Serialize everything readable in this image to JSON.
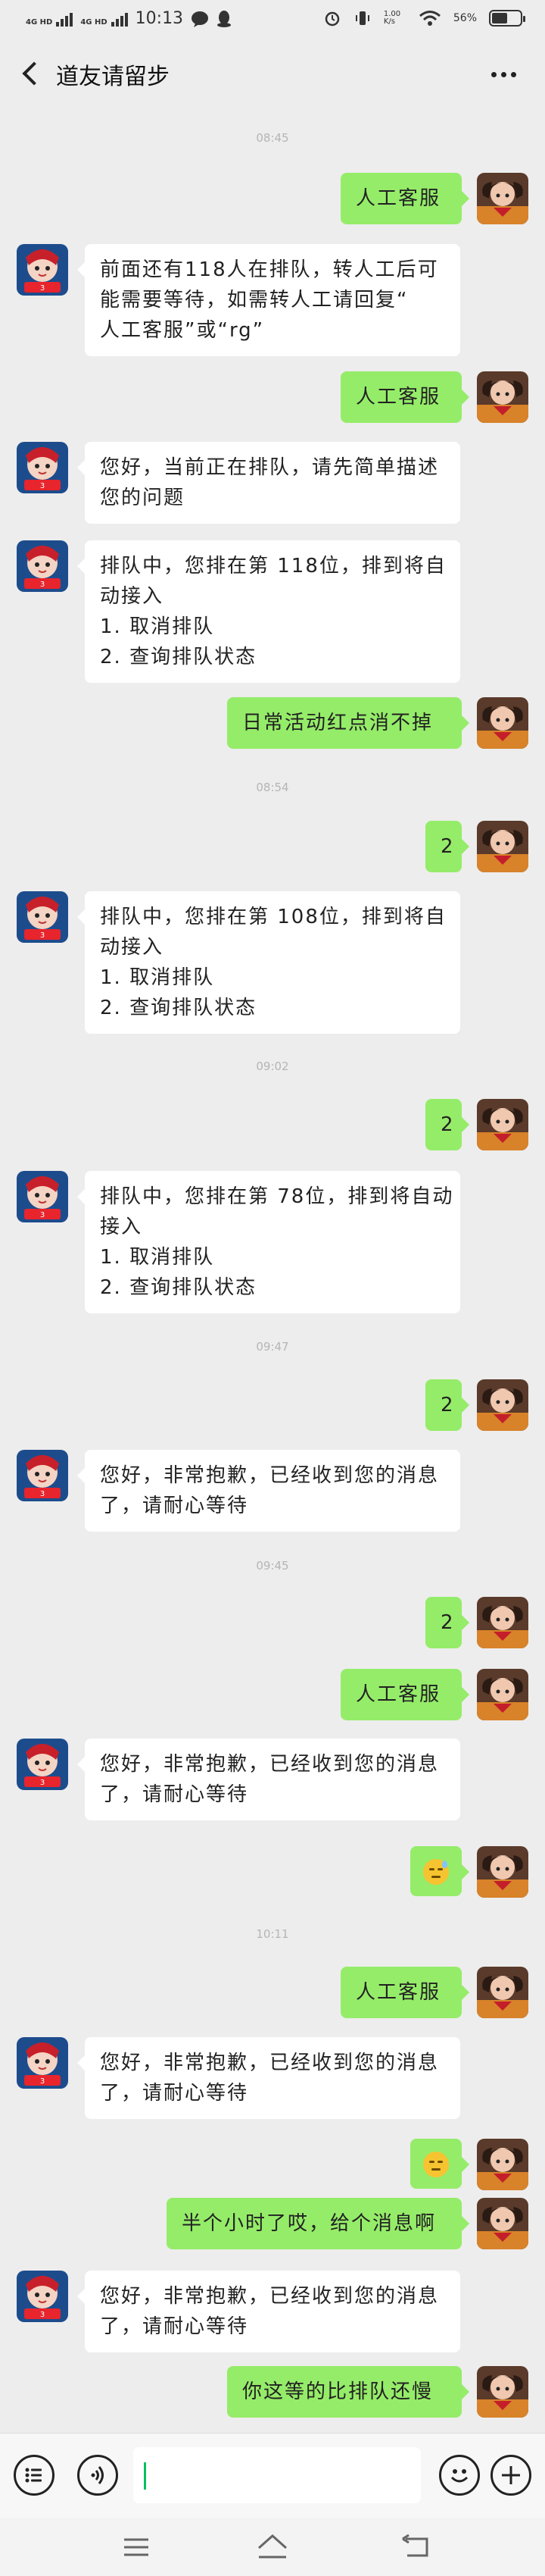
{
  "status_bar": {
    "network_1": "4G HD",
    "network_2": "4G HD",
    "time": "10:13",
    "speed": "1.00 K/s",
    "battery": "56%",
    "battery_level": 0.56
  },
  "header": {
    "title": "道友请留步"
  },
  "messages": [
    {
      "type": "time",
      "text": "08:45"
    },
    {
      "type": "out",
      "lines": [
        "人工客服"
      ]
    },
    {
      "type": "in",
      "lines": [
        "前面还有118人在排队，转人工后可",
        "能需要等待，如需转人工请回复“",
        "人工客服”或“rg”"
      ]
    },
    {
      "type": "out",
      "lines": [
        "人工客服"
      ]
    },
    {
      "type": "in",
      "lines": [
        "您好，当前正在排队，请先简单描述",
        "您的问题"
      ]
    },
    {
      "type": "in",
      "lines": [
        "排队中，您排在第 118位，排到将自",
        "动接入",
        "1. 取消排队",
        "2. 查询排队状态"
      ]
    },
    {
      "type": "out",
      "lines": [
        "日常活动红点消不掉"
      ]
    },
    {
      "type": "time",
      "text": "08:54"
    },
    {
      "type": "out",
      "lines": [
        "2"
      ]
    },
    {
      "type": "in",
      "lines": [
        "排队中，您排在第 108位，排到将自",
        "动接入",
        "1. 取消排队",
        "2. 查询排队状态"
      ]
    },
    {
      "type": "time",
      "text": "09:02"
    },
    {
      "type": "out",
      "lines": [
        "2"
      ]
    },
    {
      "type": "in",
      "lines": [
        "排队中，您排在第 78位，排到将自动",
        "接入",
        "1. 取消排队",
        "2. 查询排队状态"
      ]
    },
    {
      "type": "time",
      "text": "09:47"
    },
    {
      "type": "out",
      "lines": [
        "2"
      ]
    },
    {
      "type": "in",
      "lines": [
        "您好，非常抱歉，已经收到您的消息",
        "了，请耐心等待"
      ]
    },
    {
      "type": "time",
      "text": "09:45"
    },
    {
      "type": "out",
      "lines": [
        "2"
      ]
    },
    {
      "type": "out",
      "lines": [
        "人工客服"
      ]
    },
    {
      "type": "in",
      "lines": [
        "您好，非常抱歉，已经收到您的消息",
        "了，请耐心等待"
      ]
    },
    {
      "type": "out",
      "emoji": "sweat-smile-emoji"
    },
    {
      "type": "time",
      "text": "10:11"
    },
    {
      "type": "out",
      "lines": [
        "人工客服"
      ]
    },
    {
      "type": "in",
      "lines": [
        "您好，非常抱歉，已经收到您的消息",
        "了，请耐心等待"
      ]
    },
    {
      "type": "out",
      "emoji": "unamused-emoji"
    },
    {
      "type": "out",
      "lines": [
        "半个小时了哎，给个消息啊"
      ]
    },
    {
      "type": "in",
      "lines": [
        "您好，非常抱歉，已经收到您的消息",
        "了，请耐心等待"
      ]
    },
    {
      "type": "out",
      "lines": [
        "你这等的比排队还慢"
      ]
    }
  ],
  "input_bar": {
    "list_icon": "list-icon",
    "voice_icon": "voice-icon",
    "emoji_icon": "smile-icon",
    "plus_icon": "plus-icon",
    "value": ""
  },
  "nav_bar": {
    "menu_icon": "menu-icon",
    "home_icon": "home-icon",
    "back_icon": "back-arrow-icon"
  },
  "colors": {
    "background": "#ededed",
    "outgoing_bubble": "#95ec69",
    "incoming_bubble": "#ffffff",
    "cursor": "#07c160"
  }
}
